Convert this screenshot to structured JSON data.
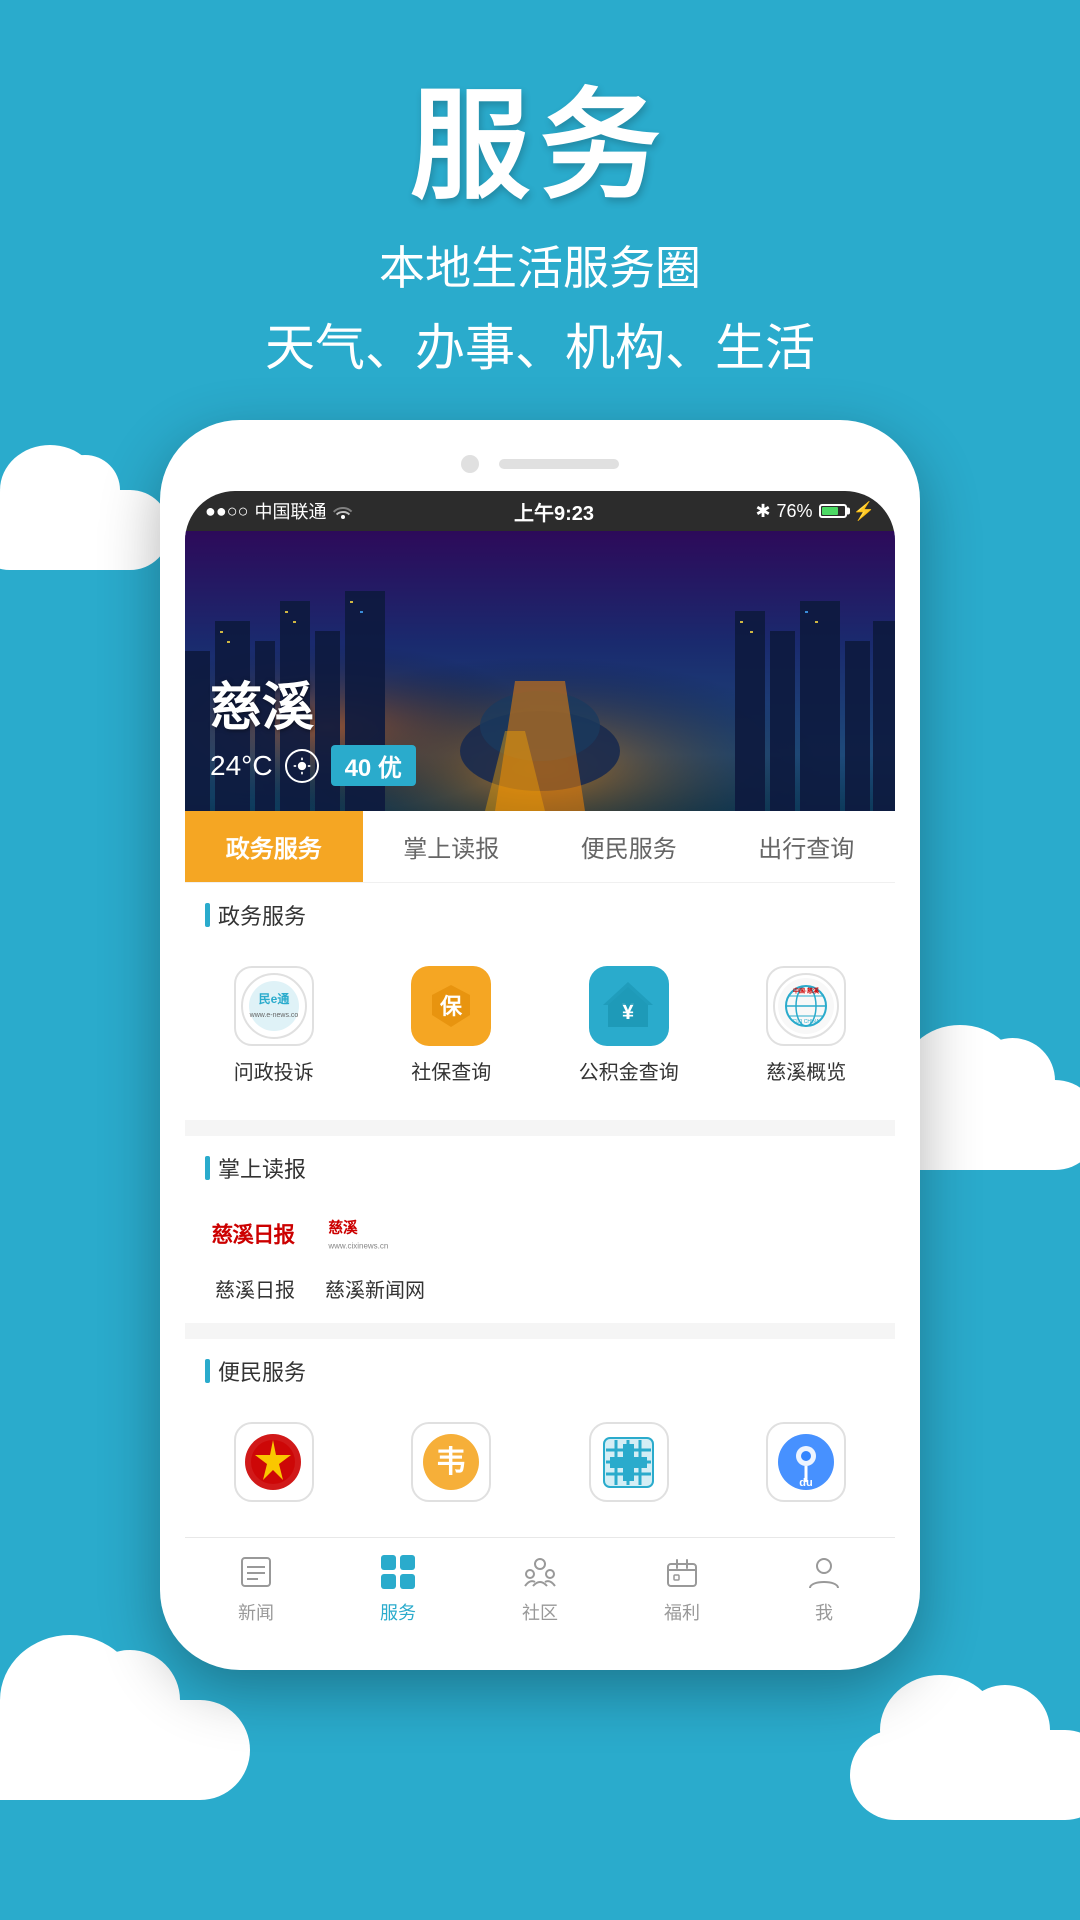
{
  "app": {
    "background_color": "#2AABCC"
  },
  "header": {
    "title": "服务",
    "subtitle1": "本地生活服务圈",
    "subtitle2": "天气、办事、机构、生活"
  },
  "status_bar": {
    "carrier": "中国联通",
    "wifi": true,
    "time": "上午9:23",
    "bluetooth": true,
    "battery": "76%"
  },
  "hero": {
    "city_name": "慈溪",
    "temperature": "24°C",
    "aqi": "40 优"
  },
  "tabs": [
    {
      "id": "zhengwu",
      "label": "政务服务",
      "active": true
    },
    {
      "id": "reading",
      "label": "掌上读报",
      "active": false
    },
    {
      "id": "citizen",
      "label": "便民服务",
      "active": false
    },
    {
      "id": "travel",
      "label": "出行查询",
      "active": false
    }
  ],
  "sections": {
    "zhengwu": {
      "title": "政务服务",
      "items": [
        {
          "id": "wenzhengtousu",
          "label": "问政投诉",
          "icon_type": "minec"
        },
        {
          "id": "shebao",
          "label": "社保查询",
          "icon_type": "shebao"
        },
        {
          "id": "gongjijin",
          "label": "公积金查询",
          "icon_type": "gongjijin"
        },
        {
          "id": "cixigailan",
          "label": "慈溪概览",
          "icon_type": "cixi"
        }
      ]
    },
    "reading": {
      "title": "掌上读报",
      "items": [
        {
          "id": "cixidaily",
          "label": "慈溪日报",
          "icon_type": "cixidaily"
        },
        {
          "id": "cixinews",
          "label": "慈溪新闻网",
          "icon_type": "cixinews"
        }
      ]
    },
    "citizen": {
      "title": "便民服务",
      "items": [
        {
          "id": "court",
          "label": "",
          "icon_type": "court"
        },
        {
          "id": "market",
          "label": "",
          "icon_type": "market"
        },
        {
          "id": "hospital",
          "label": "",
          "icon_type": "hospital"
        },
        {
          "id": "map",
          "label": "",
          "icon_type": "map"
        }
      ]
    }
  },
  "bottom_nav": {
    "items": [
      {
        "id": "news",
        "label": "新闻",
        "active": false
      },
      {
        "id": "service",
        "label": "服务",
        "active": true
      },
      {
        "id": "community",
        "label": "社区",
        "active": false
      },
      {
        "id": "welfare",
        "label": "福利",
        "active": false
      },
      {
        "id": "me",
        "label": "我",
        "active": false
      }
    ]
  }
}
